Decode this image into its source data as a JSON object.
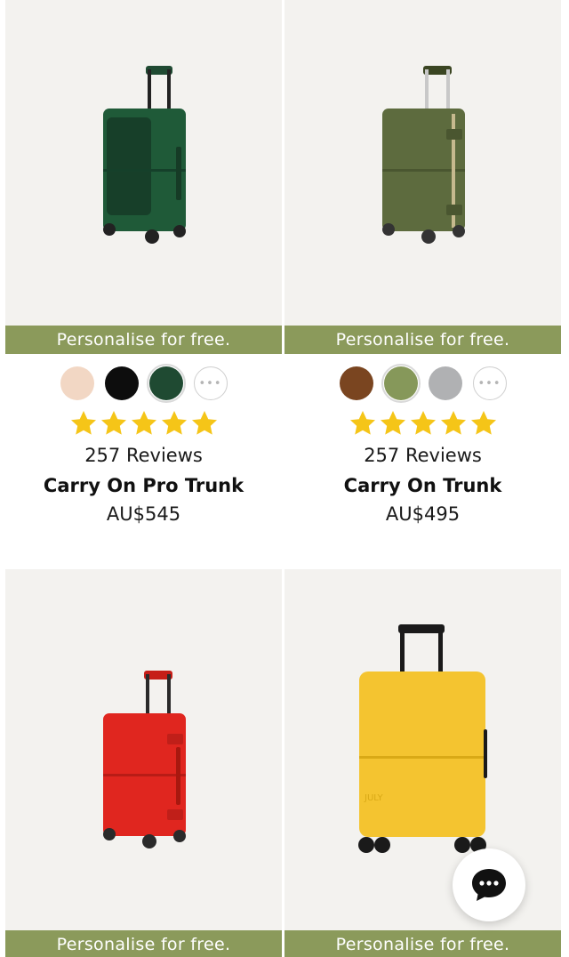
{
  "products": [
    {
      "banner": "Personalise for free.",
      "swatches": [
        "#f2d7c4",
        "#0d0d0d",
        "#1f4a32",
        "more"
      ],
      "selected_swatch": 2,
      "rating": 5,
      "reviews": "257 Reviews",
      "name": "Carry On Pro Trunk",
      "price": "AU$545",
      "suitcase_color": "#1f5a38"
    },
    {
      "banner": "Personalise for free.",
      "swatches": [
        "#7a4520",
        "#86985a",
        "#b0b1b3",
        "more"
      ],
      "selected_swatch": 1,
      "rating": 5,
      "reviews": "257 Reviews",
      "name": "Carry On Trunk",
      "price": "AU$495",
      "suitcase_color": "#5d6b3e"
    },
    {
      "banner": "Personalise for free.",
      "suitcase_color": "#e0261f"
    },
    {
      "banner": "Personalise for free.",
      "suitcase_color": "#f4c430"
    }
  ],
  "colors": {
    "banner_bg": "#8b9a5b",
    "star": "#f5c518",
    "image_bg": "#f3f2ef"
  },
  "chat": {
    "icon": "chat-bubble-icon"
  }
}
